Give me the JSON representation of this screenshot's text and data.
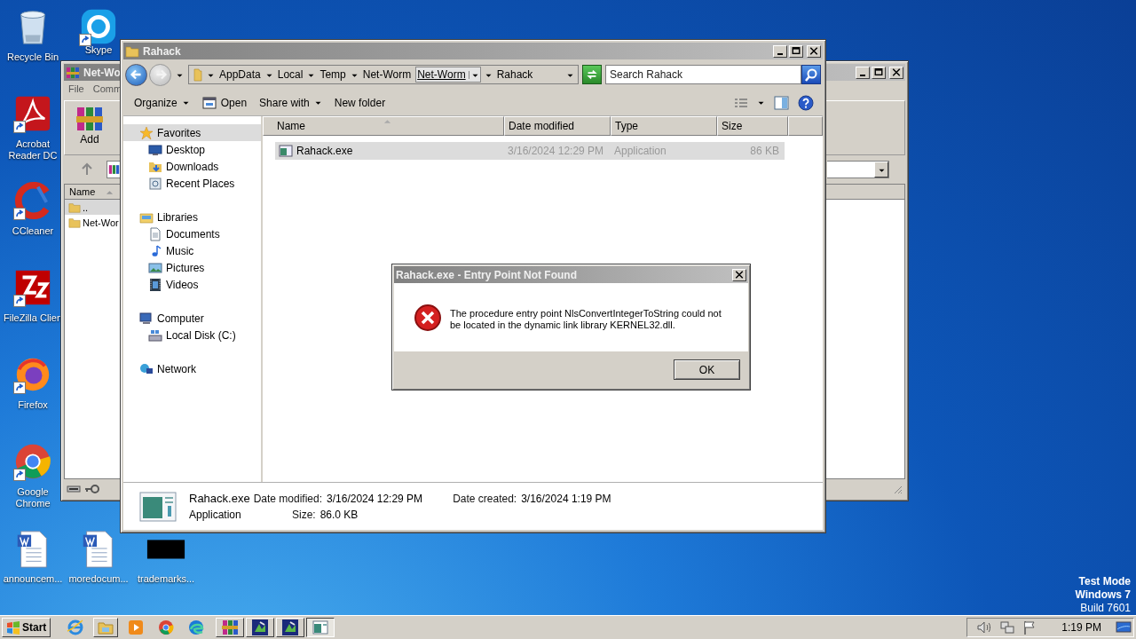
{
  "desktop": {
    "icons": [
      {
        "label": "Recycle Bin",
        "kind": "recycle",
        "shortcut": false
      },
      {
        "label": "Skype",
        "kind": "skype",
        "shortcut": true
      },
      {
        "label": "Acrobat Reader DC",
        "kind": "acrobat",
        "shortcut": true
      },
      {
        "label": "CCleaner",
        "kind": "ccleaner",
        "shortcut": true
      },
      {
        "label": "FileZilla Clien",
        "kind": "filezilla",
        "shortcut": true
      },
      {
        "label": "Firefox",
        "kind": "firefox",
        "shortcut": true
      },
      {
        "label": "Google Chrome",
        "kind": "chrome",
        "shortcut": true
      },
      {
        "label": "announcem...",
        "kind": "word",
        "shortcut": false
      },
      {
        "label": "moredocum...",
        "kind": "word",
        "shortcut": false
      },
      {
        "label": "trademarks...",
        "kind": "thumbnail",
        "shortcut": false
      }
    ]
  },
  "winrar_window": {
    "title": "Net-Wo",
    "menu": [
      "File",
      "Comm"
    ],
    "toolbar": [
      {
        "label": "Add"
      }
    ],
    "list": {
      "column": {
        "label": "Name",
        "sorted": true
      },
      "rows": [
        {
          "name": "..",
          "selected": true
        },
        {
          "name": "Net-Wor",
          "selected": false
        }
      ]
    }
  },
  "explorer_window": {
    "title": "Rahack",
    "breadcrumb": [
      {
        "label": "AppData",
        "highlighted": false
      },
      {
        "label": "Local",
        "highlighted": false
      },
      {
        "label": "Temp",
        "highlighted": false
      },
      {
        "label": "Net-Worm",
        "highlighted": false
      },
      {
        "label": "Net-Worm",
        "highlighted": true
      },
      {
        "label": "Rahack",
        "highlighted": false
      }
    ],
    "search": {
      "placeholder": "Search Rahack"
    },
    "commands": [
      {
        "label": "Organize",
        "kind": "plain",
        "dropdown": true
      },
      {
        "label": "Open",
        "kind": "open",
        "dropdown": false
      },
      {
        "label": "Share with",
        "kind": "plain",
        "dropdown": true
      },
      {
        "label": "New folder",
        "kind": "plain",
        "dropdown": false
      }
    ],
    "navigation": [
      {
        "label": "Favorites",
        "kind": "star",
        "selected": true,
        "children": [
          {
            "label": "Desktop",
            "kind": "desktop",
            "selected": false
          },
          {
            "label": "Downloads",
            "kind": "downloads",
            "selected": false
          },
          {
            "label": "Recent Places",
            "kind": "recent",
            "selected": false
          }
        ]
      },
      {
        "label": "Libraries",
        "kind": "libraries",
        "selected": false,
        "children": [
          {
            "label": "Documents",
            "kind": "documents",
            "selected": false
          },
          {
            "label": "Music",
            "kind": "music",
            "selected": false
          },
          {
            "label": "Pictures",
            "kind": "pictures",
            "selected": false
          },
          {
            "label": "Videos",
            "kind": "videos",
            "selected": false
          }
        ]
      },
      {
        "label": "Computer",
        "kind": "computer",
        "selected": false,
        "children": [
          {
            "label": "Local Disk (C:)",
            "kind": "disk",
            "selected": false
          }
        ]
      },
      {
        "label": "Network",
        "kind": "network",
        "selected": false
      }
    ],
    "file_list": {
      "columns": [
        {
          "label": "Name",
          "sorted": true
        },
        {
          "label": "Date modified",
          "sorted": false
        },
        {
          "label": "Type",
          "sorted": false
        },
        {
          "label": "Size",
          "sorted": false
        }
      ],
      "rows": [
        {
          "cells": [
            "Rahack.exe",
            "3/16/2024 12:29 PM",
            "Application",
            "86 KB"
          ],
          "selected": true
        }
      ]
    },
    "details_pane": {
      "name": "Rahack.exe",
      "type": "Application",
      "fields": [
        {
          "label": "Date modified:",
          "value": "3/16/2024 12:29 PM"
        },
        {
          "label": "Size:",
          "value": "86.0 KB"
        },
        {
          "label": "Date created:",
          "value": "3/16/2024 1:19 PM"
        }
      ]
    }
  },
  "dialog": {
    "title": "Rahack.exe - Entry Point Not Found",
    "message": "The procedure entry point NlsConvertIntegerToString could not be located in the dynamic link library KERNEL32.dll.",
    "buttons": [
      {
        "label": "OK"
      }
    ]
  },
  "taskbar": {
    "start": "Start",
    "quick_launch": [
      {
        "kind": "ie"
      },
      {
        "kind": "folder"
      },
      {
        "kind": "media"
      },
      {
        "kind": "chrome"
      },
      {
        "kind": "edge"
      }
    ],
    "tasks": [
      {
        "kind": "winrar",
        "selected": false
      },
      {
        "kind": "app",
        "selected": false
      },
      {
        "kind": "app",
        "selected": false
      },
      {
        "kind": "window",
        "selected": true
      }
    ],
    "tray": {
      "clock": "1:19 PM"
    }
  },
  "system_notice": [
    {
      "text": "Test Mode",
      "bold": true
    },
    {
      "text": "Windows 7",
      "bold": true
    },
    {
      "text": "Build 7601",
      "bold": false
    }
  ]
}
